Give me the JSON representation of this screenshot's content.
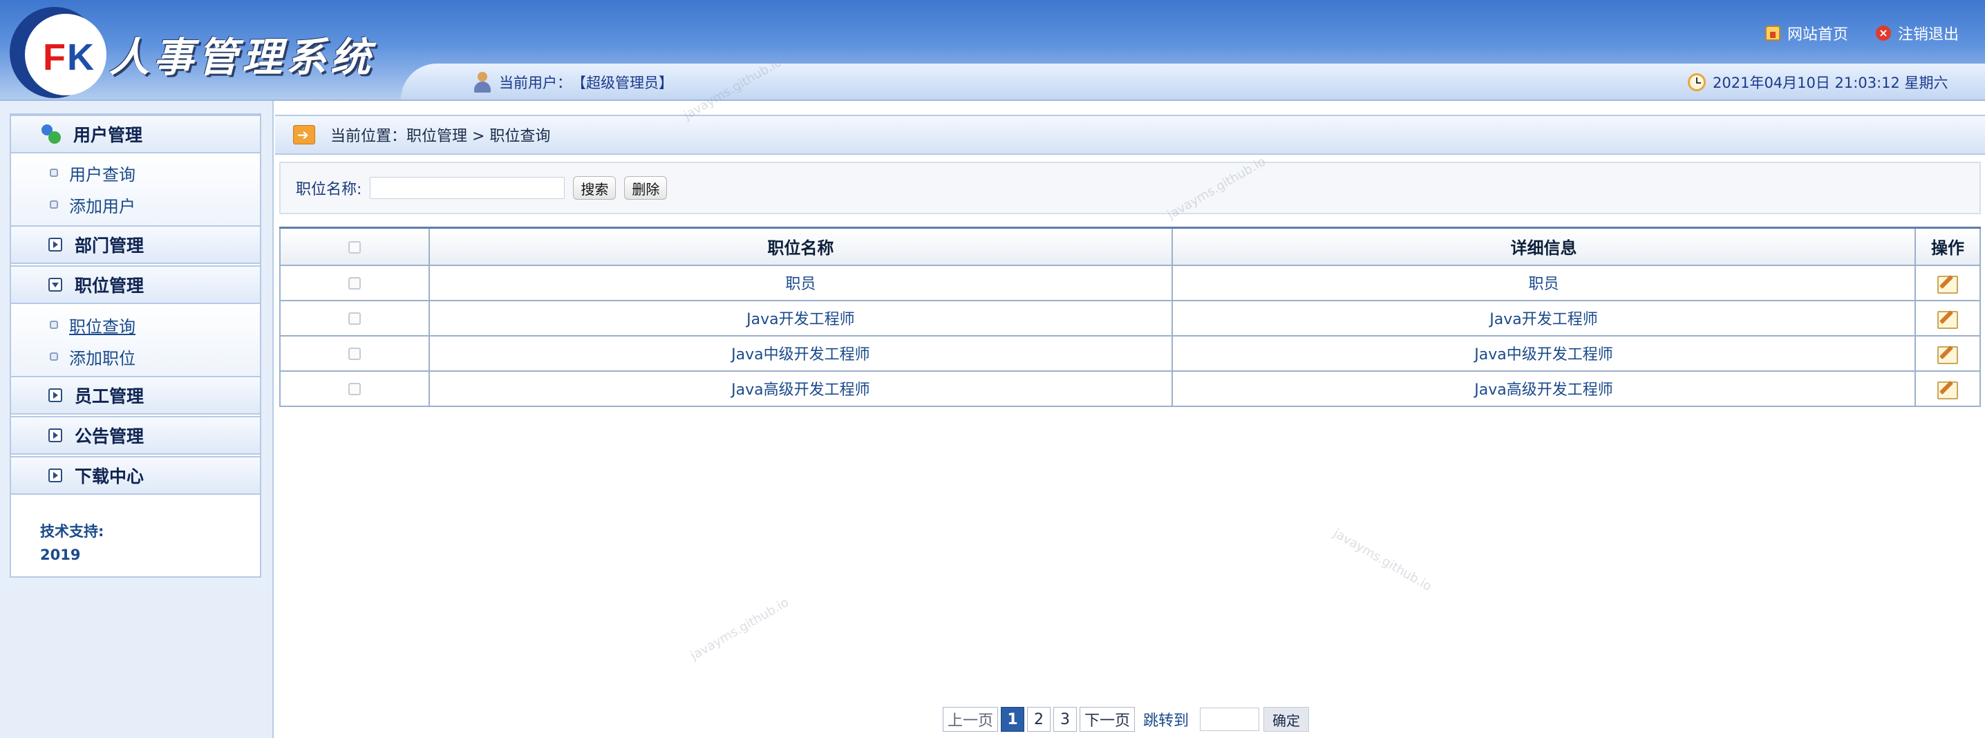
{
  "header": {
    "logo_letters": "FK",
    "app_title": "人事管理系统",
    "home_link": "网站首页",
    "logout_link": "注销退出",
    "current_user_label": "当前用户：",
    "current_user_value": "【超级管理员】",
    "datetime": "2021年04月10日 21:03:12 星期六"
  },
  "sidebar": {
    "menus": [
      {
        "label": "用户管理",
        "icon": "users-icon",
        "expanded": true,
        "items": [
          "用户查询",
          "添加用户"
        ]
      },
      {
        "label": "部门管理",
        "icon": "collapse-toggle-icon",
        "expanded": false,
        "items": []
      },
      {
        "label": "职位管理",
        "icon": "expand-toggle-icon",
        "expanded": true,
        "items": [
          "职位查询",
          "添加职位"
        ]
      },
      {
        "label": "员工管理",
        "icon": "collapse-toggle-icon",
        "expanded": false,
        "items": []
      },
      {
        "label": "公告管理",
        "icon": "collapse-toggle-icon",
        "expanded": false,
        "items": []
      },
      {
        "label": "下载中心",
        "icon": "collapse-toggle-icon",
        "expanded": false,
        "items": []
      }
    ],
    "active_item": "职位查询",
    "support_label": "技术支持:",
    "support_year": "2019"
  },
  "breadcrumb": {
    "text": "当前位置：职位管理 > 职位查询"
  },
  "search": {
    "label": "职位名称:",
    "value": "",
    "search_button": "搜索",
    "delete_button": "删除"
  },
  "table": {
    "headers": [
      "",
      "职位名称",
      "详细信息",
      "操作"
    ],
    "rows": [
      {
        "name": "职员",
        "detail": "职员"
      },
      {
        "name": "Java开发工程师",
        "detail": "Java开发工程师"
      },
      {
        "name": "Java中级开发工程师",
        "detail": "Java中级开发工程师"
      },
      {
        "name": "Java高级开发工程师",
        "detail": "Java高级开发工程师"
      }
    ]
  },
  "pagination": {
    "prev": "上一页",
    "pages": [
      "1",
      "2",
      "3"
    ],
    "current": "1",
    "next": "下一页",
    "jump_label": "跳转到",
    "confirm": "确定"
  },
  "watermark": "javayms.github.io",
  "colors": {
    "header_blue": "#3e77cf",
    "link_blue": "#1a4a8a",
    "page_current": "#2b5ea8",
    "sidebar_bg": "#e6eefa"
  }
}
